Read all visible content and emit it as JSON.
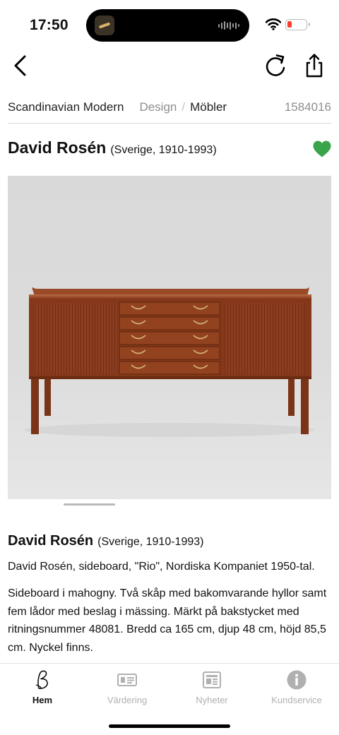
{
  "status": {
    "time": "17:50"
  },
  "breadcrumb": {
    "category": "Scandinavian Modern",
    "section": "Design",
    "separator": "/",
    "subsection": "Möbler",
    "lot_number": "1584016"
  },
  "artist": {
    "name": "David Rosén",
    "meta": "(Sverige, 1910-1993)"
  },
  "details": {
    "name": "David Rosén",
    "meta": "(Sverige, 1910-1993)",
    "summary": "David Rosén, sideboard, \"Rio\", Nordiska Kompaniet 1950-tal.",
    "description": "Sideboard i mahogny. Två skåp med bakomvarande hyllor samt fem lådor med beslag i mässing. Märkt på bakstycket med ritningsnummer 48081. Bredd ca 165 cm, djup 48 cm, höjd 85,5 cm. Nyckel finns."
  },
  "icons": {
    "back": "chevron-left-icon",
    "reload": "reload-icon",
    "share": "share-icon",
    "favorite": "heart-icon"
  },
  "colors": {
    "favorite": "#3aa44a",
    "text": "#111111",
    "muted": "#8e8e8e",
    "wood": "#8b3c1f"
  },
  "tabs": [
    {
      "label": "Hem",
      "icon": "home-logo-icon",
      "active": true
    },
    {
      "label": "Värdering",
      "icon": "valuation-icon",
      "active": false
    },
    {
      "label": "Nyheter",
      "icon": "news-icon",
      "active": false
    },
    {
      "label": "Kundservice",
      "icon": "info-icon",
      "active": false
    }
  ]
}
